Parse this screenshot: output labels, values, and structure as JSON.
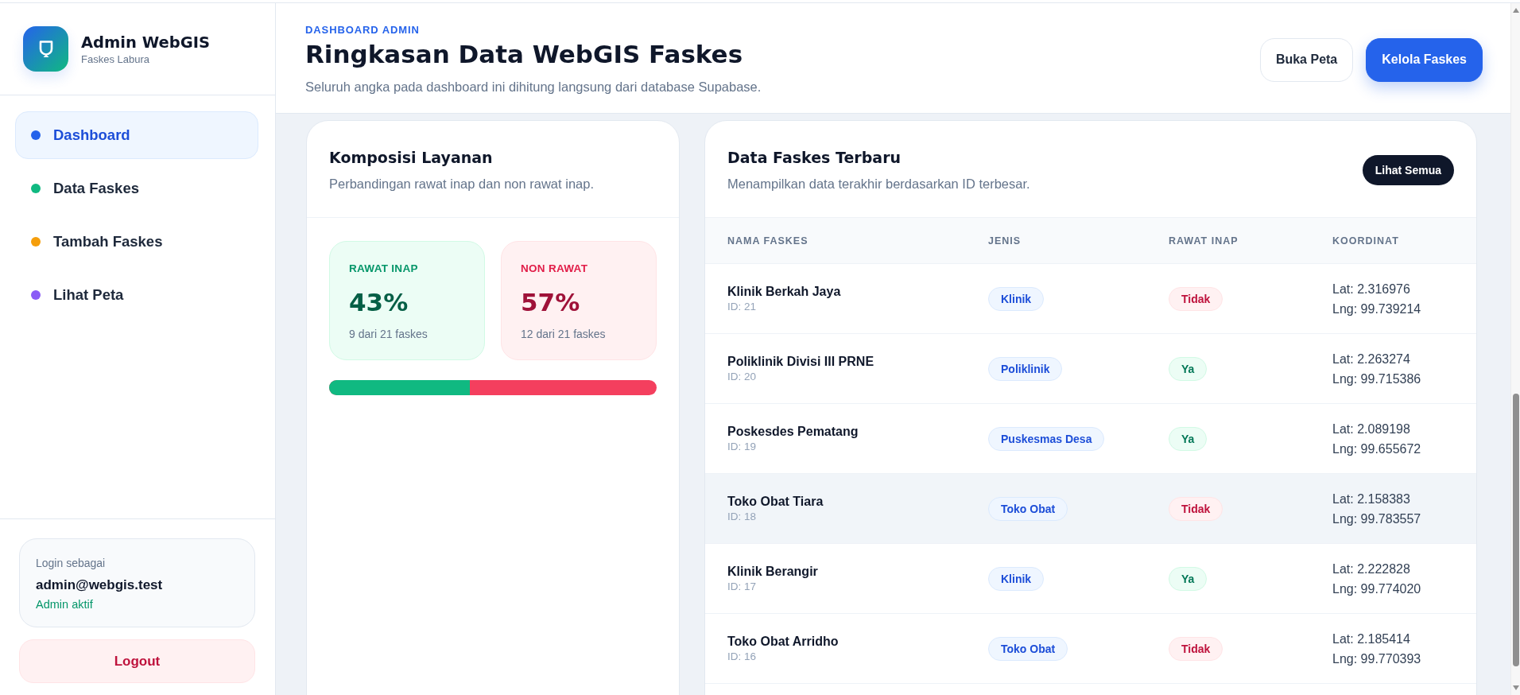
{
  "sidebar": {
    "brand": {
      "title": "Admin WebGIS",
      "subtitle": "Faskes Labura"
    },
    "nav": [
      {
        "label": "Dashboard",
        "selected": true,
        "color": "#2563eb"
      },
      {
        "label": "Data Faskes",
        "selected": false,
        "color": "#10b981"
      },
      {
        "label": "Tambah Faskes",
        "selected": false,
        "color": "#f59e0b"
      },
      {
        "label": "Lihat Peta",
        "selected": false,
        "color": "#8b5cf6"
      }
    ],
    "user": {
      "caption": "Login sebagai",
      "email": "admin@webgis.test",
      "status": "Admin aktif"
    },
    "logout": "Logout"
  },
  "header": {
    "eyebrow": "DASHBOARD ADMIN",
    "title": "Ringkasan Data WebGIS Faskes",
    "subtitle": "Seluruh angka pada dashboard ini dihitung langsung dari database Supabase.",
    "buttons": [
      {
        "label": "Buka Peta",
        "kind": "secondary"
      },
      {
        "label": "Kelola Faskes",
        "kind": "primary"
      }
    ]
  },
  "composition": {
    "title": "Komposisi Layanan",
    "subtitle": "Perbandingan rawat inap dan non rawat inap.",
    "stats": [
      {
        "kind": "inpatient",
        "label": "RAWAT INAP",
        "value": "43%",
        "caption": "9 dari 21 faskes"
      },
      {
        "kind": "outpatient",
        "label": "NON RAWAT",
        "value": "57%",
        "caption": "12 dari 21 faskes"
      }
    ],
    "bar": {
      "level": 0.43
    }
  },
  "latest": {
    "title": "Data Faskes Terbaru",
    "subtitle": "Menampilkan data terakhir berdasarkan ID terbesar.",
    "button": "Lihat Semua",
    "table": {
      "columns": [
        "NAMA FASKES",
        "JENIS",
        "RAWAT INAP",
        "KOORDINAT"
      ],
      "rows": [
        {
          "name": "Klinik Berkah Jaya",
          "id": "ID: 21",
          "type": "Klinik",
          "inpatient": {
            "label": "Tidak",
            "value": false
          },
          "lat": "Lat: 2.316976",
          "lng": "Lng: 99.739214",
          "hovered": false
        },
        {
          "name": "Poliklinik Divisi III PRNE",
          "id": "ID: 20",
          "type": "Poliklinik",
          "inpatient": {
            "label": "Ya",
            "value": true
          },
          "lat": "Lat: 2.263274",
          "lng": "Lng: 99.715386",
          "hovered": false
        },
        {
          "name": "Poskesdes Pematang",
          "id": "ID: 19",
          "type": "Puskesmas Desa",
          "inpatient": {
            "label": "Ya",
            "value": true
          },
          "lat": "Lat: 2.089198",
          "lng": "Lng: 99.655672",
          "hovered": false
        },
        {
          "name": "Toko Obat Tiara",
          "id": "ID: 18",
          "type": "Toko Obat",
          "inpatient": {
            "label": "Tidak",
            "value": false
          },
          "lat": "Lat: 2.158383",
          "lng": "Lng: 99.783557",
          "hovered": true
        },
        {
          "name": "Klinik Berangir",
          "id": "ID: 17",
          "type": "Klinik",
          "inpatient": {
            "label": "Ya",
            "value": true
          },
          "lat": "Lat: 2.222828",
          "lng": "Lng: 99.774020",
          "hovered": false
        },
        {
          "name": "Toko Obat Arridho",
          "id": "ID: 16",
          "type": "Toko Obat",
          "inpatient": {
            "label": "Tidak",
            "value": false
          },
          "lat": "Lat: 2.185414",
          "lng": "Lng: 99.770393",
          "hovered": false
        }
      ]
    }
  }
}
